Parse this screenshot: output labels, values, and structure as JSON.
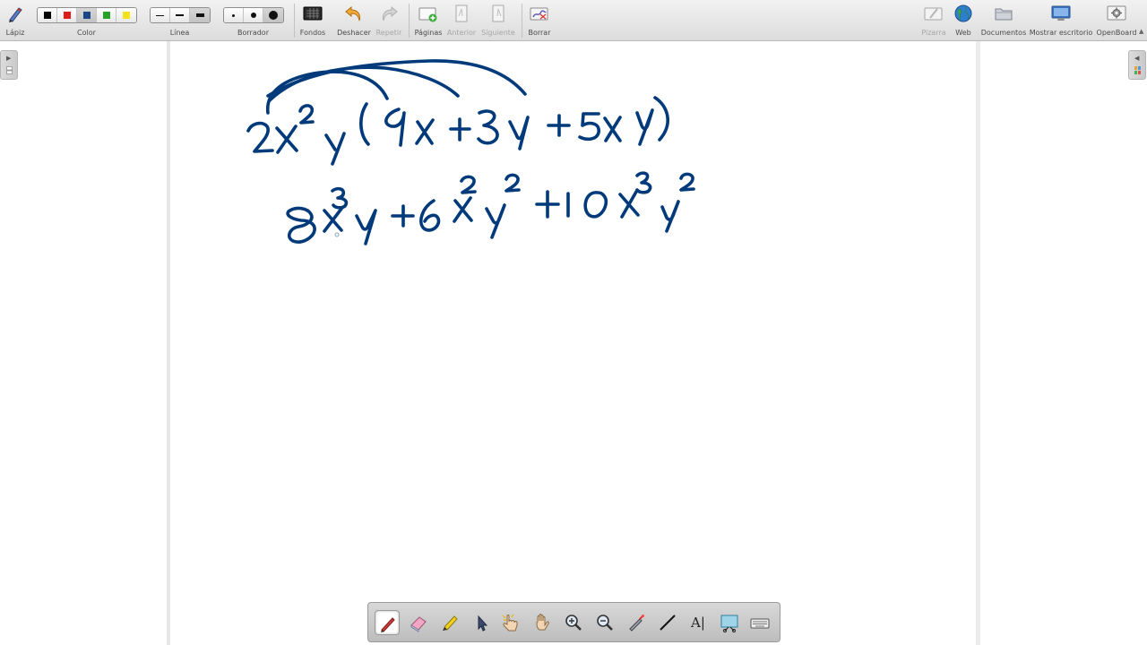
{
  "toolbar": {
    "pen": "Lápiz",
    "color": "Color",
    "line": "Línea",
    "eraser": "Borrador",
    "backgrounds": "Fondos",
    "undo": "Deshacer",
    "redo": "Repetir",
    "pages": "Páginas",
    "previous": "Anterior",
    "next": "Siguiente",
    "clear": "Borrar",
    "board": "Pizarra",
    "web": "Web",
    "documents": "Documentos",
    "show_desktop": "Mostrar escritorio",
    "openboard": "OpenBoard"
  },
  "color_palette": [
    "#000000",
    "#e01b1b",
    "#1c4587",
    "#27a327",
    "#f3e11a"
  ],
  "selected_color_index": 2,
  "ink_color": "#003a7a",
  "line_widths": [
    "thin",
    "medium",
    "thick"
  ],
  "eraser_sizes": [
    "small",
    "medium",
    "large"
  ],
  "board_content": {
    "expression": "2x²y(4x + 3y + 5xy)",
    "result": "8x³y + 6x²y² + 10x³y²"
  },
  "bottom_tools": [
    {
      "name": "pen",
      "icon": "pen-icon",
      "active": true
    },
    {
      "name": "eraser",
      "icon": "eraser-icon"
    },
    {
      "name": "marker",
      "icon": "marker-icon"
    },
    {
      "name": "selector",
      "icon": "cursor-icon"
    },
    {
      "name": "interact",
      "icon": "pointing-hand-icon"
    },
    {
      "name": "hand",
      "icon": "hand-icon"
    },
    {
      "name": "zoom-in",
      "icon": "zoom-in-icon"
    },
    {
      "name": "zoom-out",
      "icon": "zoom-out-icon"
    },
    {
      "name": "laser",
      "icon": "laser-pointer-icon"
    },
    {
      "name": "line",
      "icon": "line-icon"
    },
    {
      "name": "text",
      "icon": "text-icon",
      "label": "A|"
    },
    {
      "name": "capture",
      "icon": "capture-icon"
    },
    {
      "name": "keyboard",
      "icon": "keyboard-icon"
    }
  ]
}
